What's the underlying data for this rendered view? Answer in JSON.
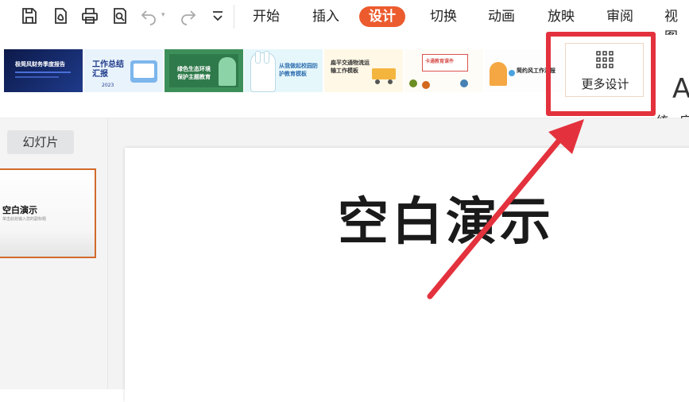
{
  "toolbar": {
    "quick_access": [
      {
        "name": "save-icon"
      },
      {
        "name": "export-pdf-icon"
      },
      {
        "name": "print-icon"
      },
      {
        "name": "print-preview-icon"
      },
      {
        "name": "undo-icon"
      },
      {
        "name": "redo-icon"
      },
      {
        "name": "customize-dropdown-icon"
      }
    ],
    "tabs": [
      {
        "label": "开始"
      },
      {
        "label": "插入"
      },
      {
        "label": "设计",
        "active": true
      },
      {
        "label": "切换"
      },
      {
        "label": "动画"
      },
      {
        "label": "放映"
      },
      {
        "label": "审阅"
      },
      {
        "label": "视图"
      }
    ],
    "accent_color": "#ec5b2e"
  },
  "design_gallery": {
    "templates": [
      {
        "title": "极简风财务季度报告",
        "subtitle": ""
      },
      {
        "title": "工作总结汇报",
        "subtitle": "2023"
      },
      {
        "title": "绿色生态环境保护主题教育",
        "subtitle": ""
      },
      {
        "title": "从我做起校园防护教育模板",
        "subtitle": ""
      },
      {
        "title": "扁平交通物流运输工作模板",
        "subtitle": ""
      },
      {
        "title": "卡通教育课件",
        "subtitle": ""
      },
      {
        "title": "简约风工作汇报",
        "subtitle": ""
      }
    ],
    "more_designs_label": "更多设计",
    "unify_label": "统一字",
    "aa_glyph": "A",
    "highlight_color": "#e3323d"
  },
  "left_panel": {
    "tab_label": "幻灯片",
    "slide": {
      "title": "空白演示",
      "subtitle": "单击此处输入您的副标题"
    }
  },
  "canvas": {
    "title": "空白演示"
  }
}
